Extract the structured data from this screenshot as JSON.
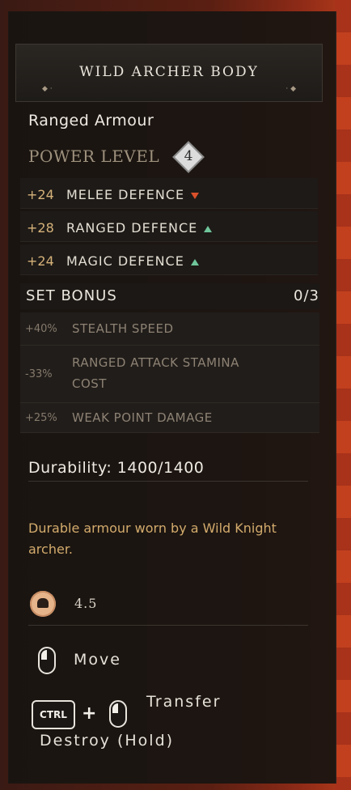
{
  "item": {
    "title": "WILD ARCHER BODY",
    "type": "Ranged Armour",
    "power_label": "POWER LEVEL",
    "power_level": "4"
  },
  "stats": [
    {
      "value": "+24",
      "name": "MELEE DEFENCE",
      "trend": "down"
    },
    {
      "value": "+28",
      "name": "RANGED DEFENCE",
      "trend": "up"
    },
    {
      "value": "+24",
      "name": "MAGIC DEFENCE",
      "trend": "up"
    }
  ],
  "set_bonus": {
    "label": "SET BONUS",
    "count": "0/3",
    "bonuses": [
      {
        "value": "+40%",
        "name": "STEALTH SPEED"
      },
      {
        "value": "-33%",
        "name": "RANGED ATTACK STAMINA COST"
      },
      {
        "value": "+25%",
        "name": "WEAK POINT DAMAGE"
      }
    ]
  },
  "durability": "Durability: 1400/1400",
  "description": "Durable armour worn by a Wild Knight archer.",
  "weight": "4.5",
  "controls": {
    "move_label": "Move",
    "ctrl_key": "CTRL",
    "plus": "+",
    "transfer_label": "Transfer",
    "destroy_label": "Destroy (Hold)"
  },
  "colors": {
    "stat_value": "#d6b27a",
    "arrow_up": "#6fc59a",
    "arrow_down": "#d9502a",
    "description": "#d3ab6c"
  }
}
